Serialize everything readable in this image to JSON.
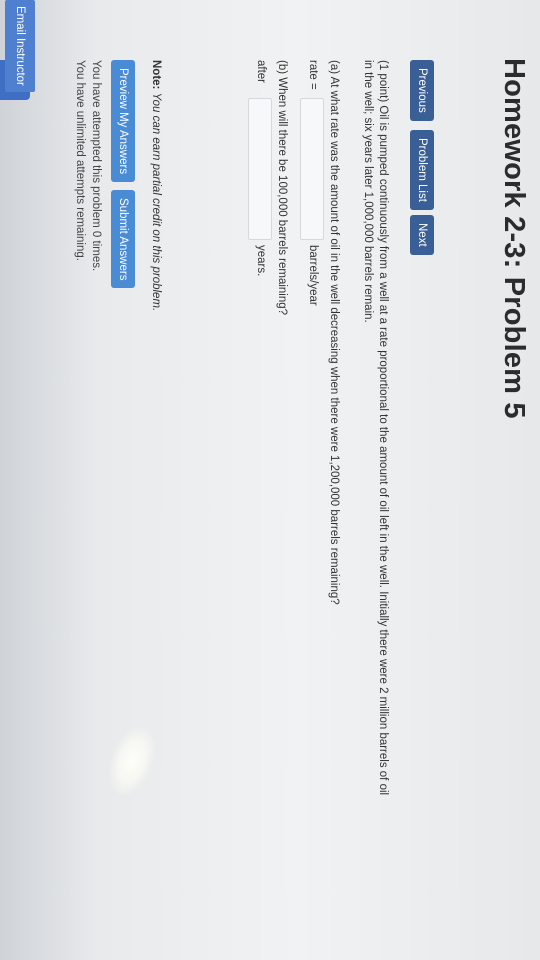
{
  "title": "Homework 2-3: Problem 5",
  "nav": {
    "previous": "Previous",
    "problem_list": "Problem List",
    "next": "Next"
  },
  "problem": {
    "statement_line1": "(1 point) Oil is pumped continuously from a well at a rate proportional to the amount of oil left in the well. Initially there were 2 million barrels of oil",
    "statement_line2": "in the well; six years later 1,000,000 barrels remain.",
    "part_a": {
      "question": "(a) At what rate was the amount of oil in the well decreasing when there were 1,200,000 barrels remaining?",
      "prefix": "rate =",
      "suffix": "barrels/year",
      "value": ""
    },
    "part_b": {
      "question": "(b) When will there be 100,000 barrels remaining?",
      "prefix": "after",
      "suffix": "years.",
      "value": ""
    }
  },
  "note": {
    "label": "Note:",
    "text": "You can earn partial credit on this problem."
  },
  "actions": {
    "preview": "Preview My Answers",
    "submit": "Submit Answers"
  },
  "attempts": {
    "line1": "You have attempted this problem 0 times.",
    "line2": "You have unlimited attempts remaining."
  },
  "email_instructor": "Email Instructor"
}
